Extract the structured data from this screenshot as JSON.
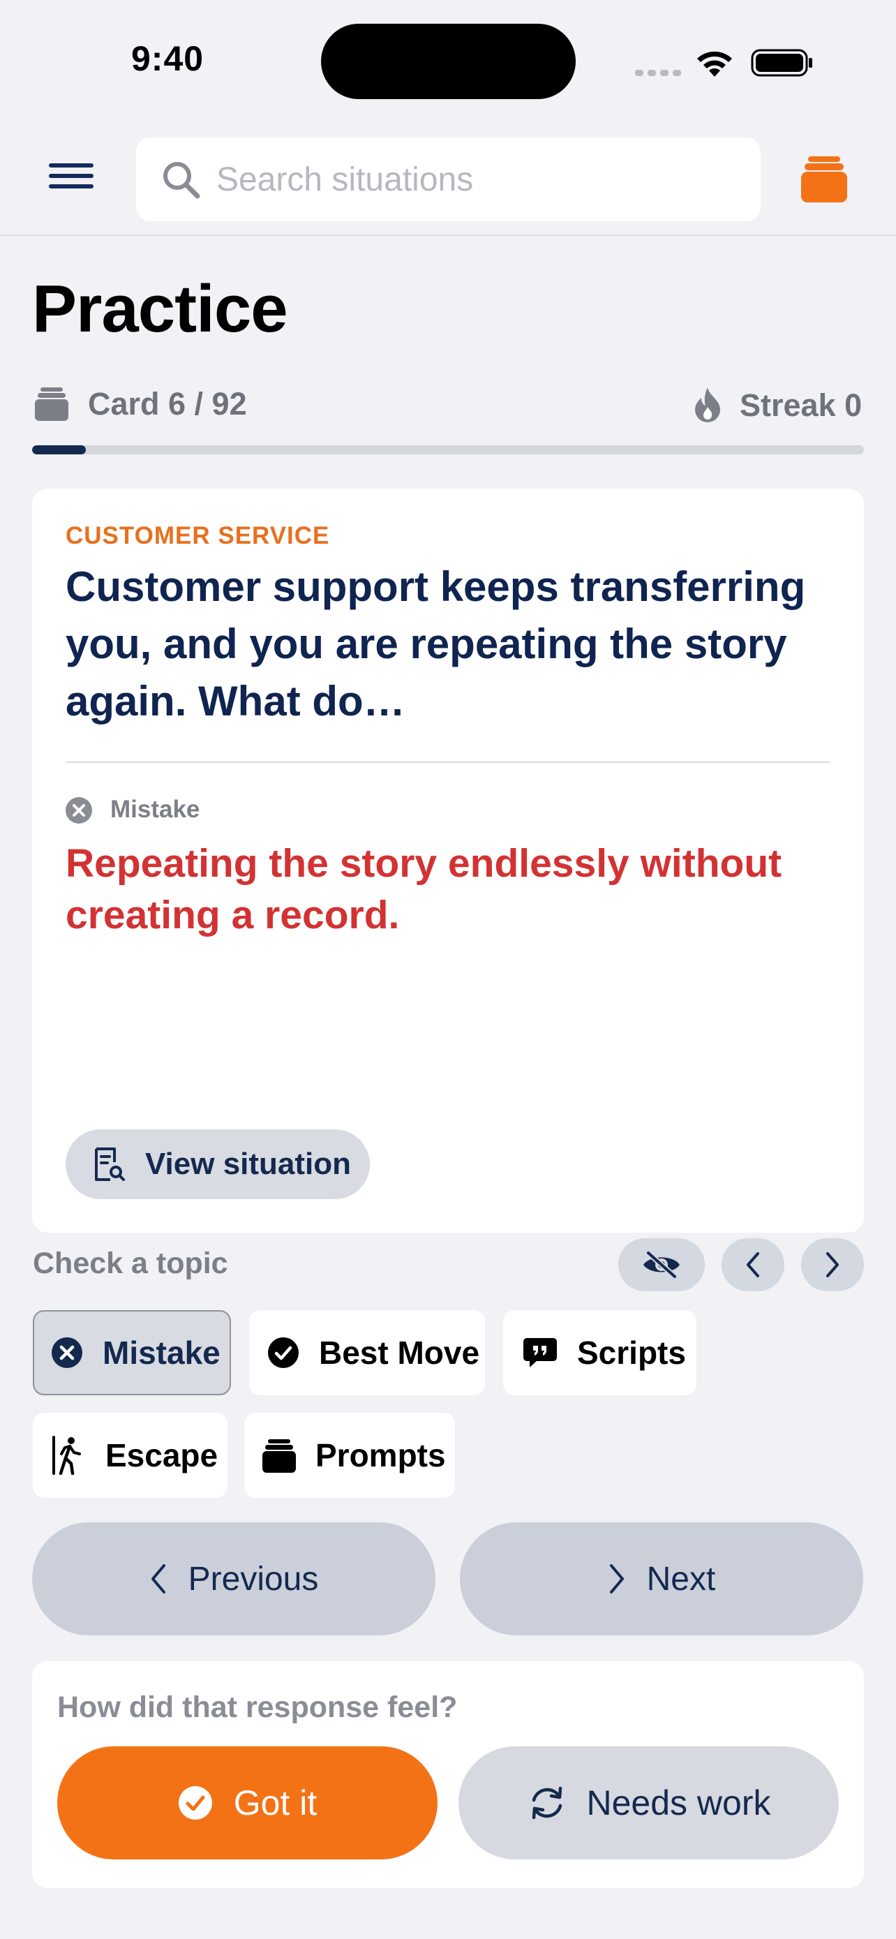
{
  "status_bar": {
    "time": "9:40"
  },
  "search": {
    "placeholder": "Search situations"
  },
  "page": {
    "title": "Practice"
  },
  "progress": {
    "card_label": "Card 6 / 92",
    "streak_label": "Streak 0",
    "fraction_complete": 0.065
  },
  "card": {
    "category": "CUSTOMER SERVICE",
    "question": "Customer support keeps transferring you, and you are repeating the story again. What do…",
    "section_label": "Mistake",
    "answer": "Repeating the story endlessly without creating a record.",
    "view_situation_label": "View situation"
  },
  "topics": {
    "heading": "Check a topic",
    "chips": [
      {
        "label": "Mistake",
        "icon": "x-circle-icon",
        "selected": true
      },
      {
        "label": "Best Move",
        "icon": "check-circle-icon",
        "selected": false
      },
      {
        "label": "Scripts",
        "icon": "quote-bubble-icon",
        "selected": false
      },
      {
        "label": "Escape",
        "icon": "exit-walk-icon",
        "selected": false
      },
      {
        "label": "Prompts",
        "icon": "card-stack-icon",
        "selected": false
      }
    ]
  },
  "navigation": {
    "previous_label": "Previous",
    "next_label": "Next"
  },
  "feedback": {
    "question": "How did that response feel?",
    "got_it_label": "Got it",
    "needs_work_label": "Needs work"
  },
  "colors": {
    "accent_orange": "#f47216",
    "navy": "#14294e",
    "mistake_red": "#d33233",
    "background": "#f1f1f6"
  }
}
